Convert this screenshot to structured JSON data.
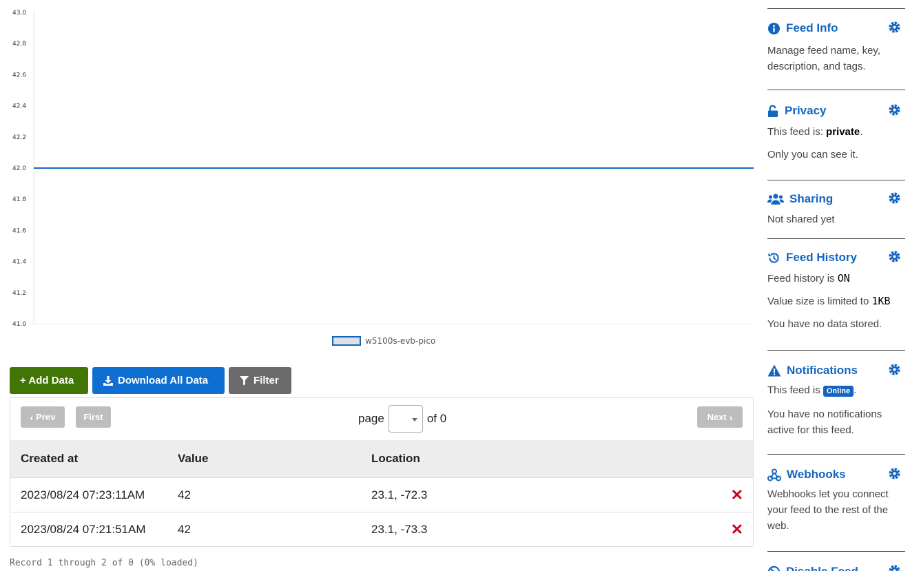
{
  "chart_data": {
    "type": "line",
    "ylim": [
      41.0,
      43.0
    ],
    "y_ticks": [
      "43.0",
      "42.8",
      "42.6",
      "42.4",
      "42.2",
      "42.0",
      "41.8",
      "41.6",
      "41.4",
      "41.2",
      "41.0"
    ],
    "series": [
      {
        "name": "w5100s-evb-pico",
        "color": "#1565c0",
        "values": [
          42,
          42
        ]
      }
    ],
    "grid": false,
    "legend": "bottom-center"
  },
  "toolbar": {
    "add_label": "+ Add Data",
    "download_label": "Download All Data",
    "filter_label": "Filter"
  },
  "pager": {
    "prev": "Prev",
    "first": "First",
    "page_label": "page",
    "of_label": "of 0",
    "next": "Next"
  },
  "table": {
    "headers": [
      "Created at",
      "Value",
      "Location"
    ],
    "rows": [
      {
        "created": "2023/08/24 07:23:11AM",
        "value": "42",
        "location": "23.1, -72.3"
      },
      {
        "created": "2023/08/24 07:21:51AM",
        "value": "42",
        "location": "23.1, -73.3"
      }
    ]
  },
  "record_note": "Record 1 through 2 of 0 (0% loaded)",
  "sidebar": {
    "feed_info": {
      "title": "Feed Info",
      "text": "Manage feed name, key, description, and tags."
    },
    "privacy": {
      "title": "Privacy",
      "prefix": "This feed is: ",
      "value": "private",
      "suffix": ".",
      "text2": "Only you can see it."
    },
    "sharing": {
      "title": "Sharing",
      "text": "Not shared yet"
    },
    "history": {
      "title": "Feed History",
      "line1": "Feed history is ",
      "status": "ON",
      "line2": "Value size is limited to ",
      "limit": "1KB",
      "line3": "You have no data stored."
    },
    "notifications": {
      "title": "Notifications",
      "prefix": "This feed is ",
      "badge": "Online",
      "suffix": ".",
      "text2": "You have no notifications active for this feed."
    },
    "webhooks": {
      "title": "Webhooks",
      "text": "Webhooks let you connect your feed to the rest of the web."
    },
    "disable": {
      "title": "Disable Feed"
    }
  },
  "colors": {
    "accent": "#1565c0",
    "green": "#417505",
    "gray_button": "#6b6b6b",
    "delete": "#d0021b"
  }
}
